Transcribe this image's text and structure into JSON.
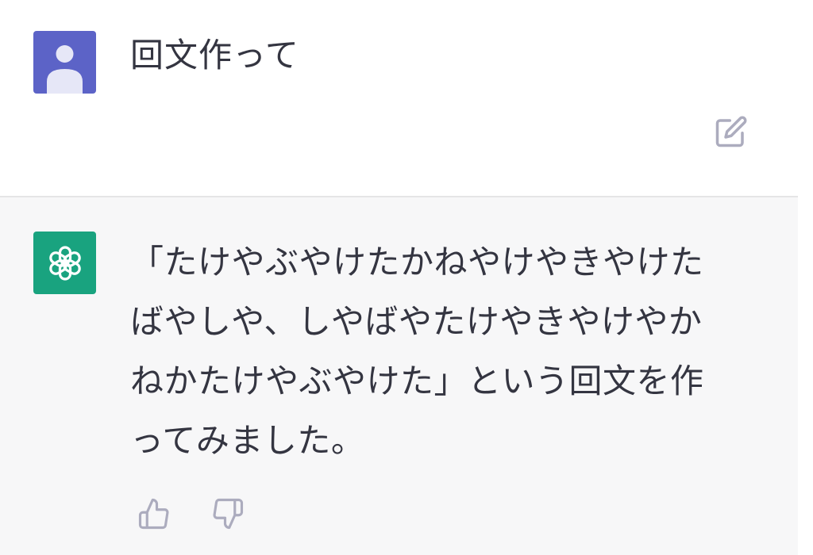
{
  "conversation": {
    "user_message": "回文作って",
    "assistant_message": "「たけやぶやけたかねやけやきやけたばやしや、しやばやたけやきやけやかねかたけやぶやけた」という回文を作ってみました。"
  },
  "icons": {
    "user_avatar": "user-silhouette-icon",
    "assistant_avatar": "openai-logo-icon",
    "edit": "edit-icon",
    "thumbs_up": "thumbs-up-icon",
    "thumbs_down": "thumbs-down-icon"
  },
  "colors": {
    "user_avatar_bg": "#5c63c7",
    "assistant_avatar_bg": "#19a37f",
    "assistant_block_bg": "#f7f7f8",
    "text": "#343541",
    "icon_gray": "#acacbe"
  }
}
